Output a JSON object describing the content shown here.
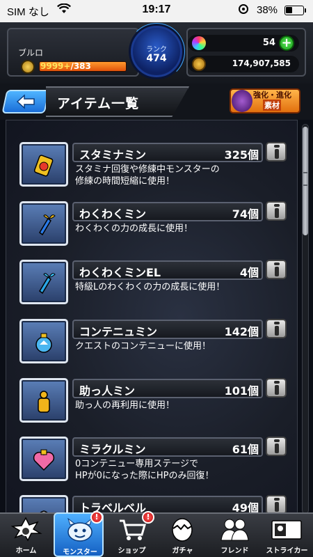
{
  "status_bar": {
    "carrier": "SIM なし",
    "time": "19:17",
    "battery": "38%",
    "battery_level": 0.38
  },
  "header": {
    "player_name": "ブルロ",
    "exp_current": "9999+",
    "exp_max": "/383",
    "rank_label": "ランク",
    "rank_value": "474",
    "orb_count": "54",
    "gold_count": "174,907,585"
  },
  "titlebar": {
    "title": "アイテム一覧",
    "evolve_line1": "強化・進化",
    "evolve_line2": "素材"
  },
  "items": [
    {
      "name": "スタミナミン",
      "qty": "325個",
      "desc": "スタミナ回復や修練中モンスターの\n修練の時間短縮に使用！",
      "icon": "stamina-can-icon",
      "color": "#e6392a"
    },
    {
      "name": "わくわくミン",
      "qty": "74個",
      "desc": "わくわくの力の成長に使用！",
      "icon": "sprout-bottle-icon",
      "color": "#d6a21a"
    },
    {
      "name": "わくわくミンEL",
      "qty": "4個",
      "desc": "特級Lのわくわくの力の成長に使用！",
      "icon": "el-bottle-icon",
      "color": "#2aa6e6"
    },
    {
      "name": "コンテニュミン",
      "qty": "142個",
      "desc": "クエストのコンテニューに使用！",
      "icon": "continue-bottle-icon",
      "color": "#4ab6f0"
    },
    {
      "name": "助っ人ミン",
      "qty": "101個",
      "desc": "助っ人の再利用に使用！",
      "icon": "helper-bottle-icon",
      "color": "#f0b41a"
    },
    {
      "name": "ミラクルミン",
      "qty": "61個",
      "desc": "0コンテニュー専用ステージで\nHPが0になった際にHPのみ回復！",
      "icon": "miracle-bottle-icon",
      "color": "#f06aa6"
    },
    {
      "name": "トラベルベル",
      "qty": "49個",
      "desc": "",
      "icon": "travel-bell-icon",
      "color": "#b0b0b0"
    }
  ],
  "bottom_nav": [
    {
      "label": "ホーム",
      "icon": "home-explosion-icon",
      "badge": ""
    },
    {
      "label": "モンスター",
      "icon": "monster-icon",
      "badge": "!"
    },
    {
      "label": "ショップ",
      "icon": "cart-icon",
      "badge": "!"
    },
    {
      "label": "ガチャ",
      "icon": "gacha-egg-icon",
      "badge": ""
    },
    {
      "label": "フレンド",
      "icon": "friend-icon",
      "badge": ""
    },
    {
      "label": "ストライカー",
      "icon": "striker-card-icon",
      "badge": ""
    }
  ]
}
